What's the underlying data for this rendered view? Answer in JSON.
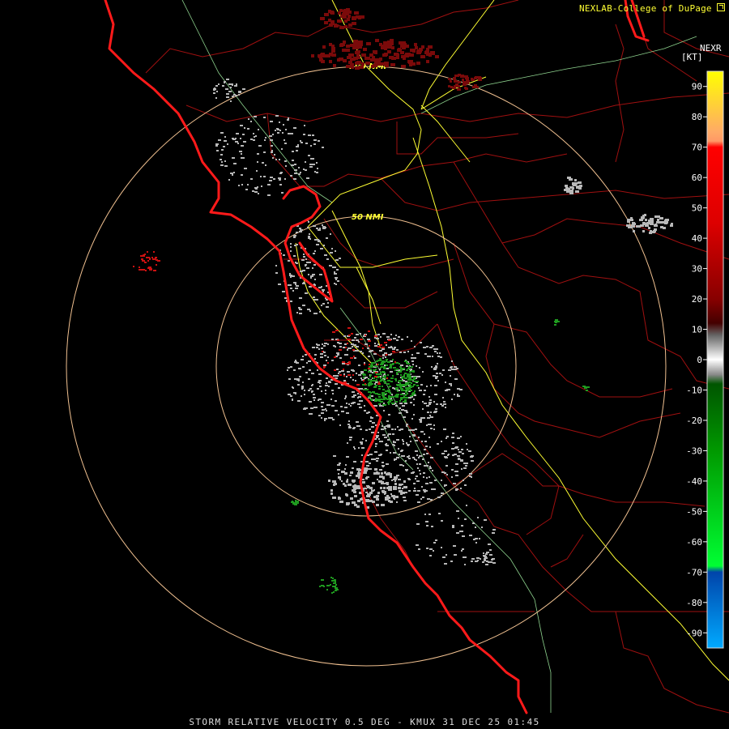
{
  "header": {
    "credit": "NEXLAB-College of DuPage",
    "product_tag": "NEXR",
    "unit_label": "[KT]"
  },
  "footer": {
    "caption": "STORM RELATIVE VELOCITY 0.5 DEG - KMUX 31 DEC 25 01:45"
  },
  "range_rings": [
    {
      "label": "50 NMI"
    },
    {
      "label": "100 NMI"
    }
  ],
  "colors": {
    "background": "#000000",
    "coastline": "#ff1a1a",
    "county_lines": "#a01010",
    "highways": "#ffff33",
    "roads": "#8fd48f",
    "range_rings": "#f0c090",
    "ring_labels": "#ffff33",
    "echo_light": "#b8b8b8",
    "echo_green": "#1f9a1f",
    "echo_maroon": "#7a0a0a"
  },
  "legend": {
    "unit": "[KT]",
    "ticks": [
      "90",
      "80",
      "70",
      "60",
      "50",
      "40",
      "30",
      "20",
      "10",
      "0",
      "-10",
      "-20",
      "-30",
      "-40",
      "-50",
      "-60",
      "-70",
      "-80",
      "-90"
    ],
    "gradient_stops": [
      {
        "value": 95,
        "color": "#ffff00"
      },
      {
        "value": 75,
        "color": "#ffaa66"
      },
      {
        "value": 72,
        "color": "#ff9966"
      },
      {
        "value": 70,
        "color": "#ff0000"
      },
      {
        "value": 45,
        "color": "#dd0000"
      },
      {
        "value": 20,
        "color": "#880000"
      },
      {
        "value": 12,
        "color": "#440000"
      },
      {
        "value": 8,
        "color": "#666666"
      },
      {
        "value": 0,
        "color": "#ffffff"
      },
      {
        "value": -5,
        "color": "#888888"
      },
      {
        "value": -8,
        "color": "#005500"
      },
      {
        "value": -30,
        "color": "#009900"
      },
      {
        "value": -68,
        "color": "#00ff33"
      },
      {
        "value": -70,
        "color": "#0044aa"
      },
      {
        "value": -95,
        "color": "#00aaff"
      }
    ]
  }
}
